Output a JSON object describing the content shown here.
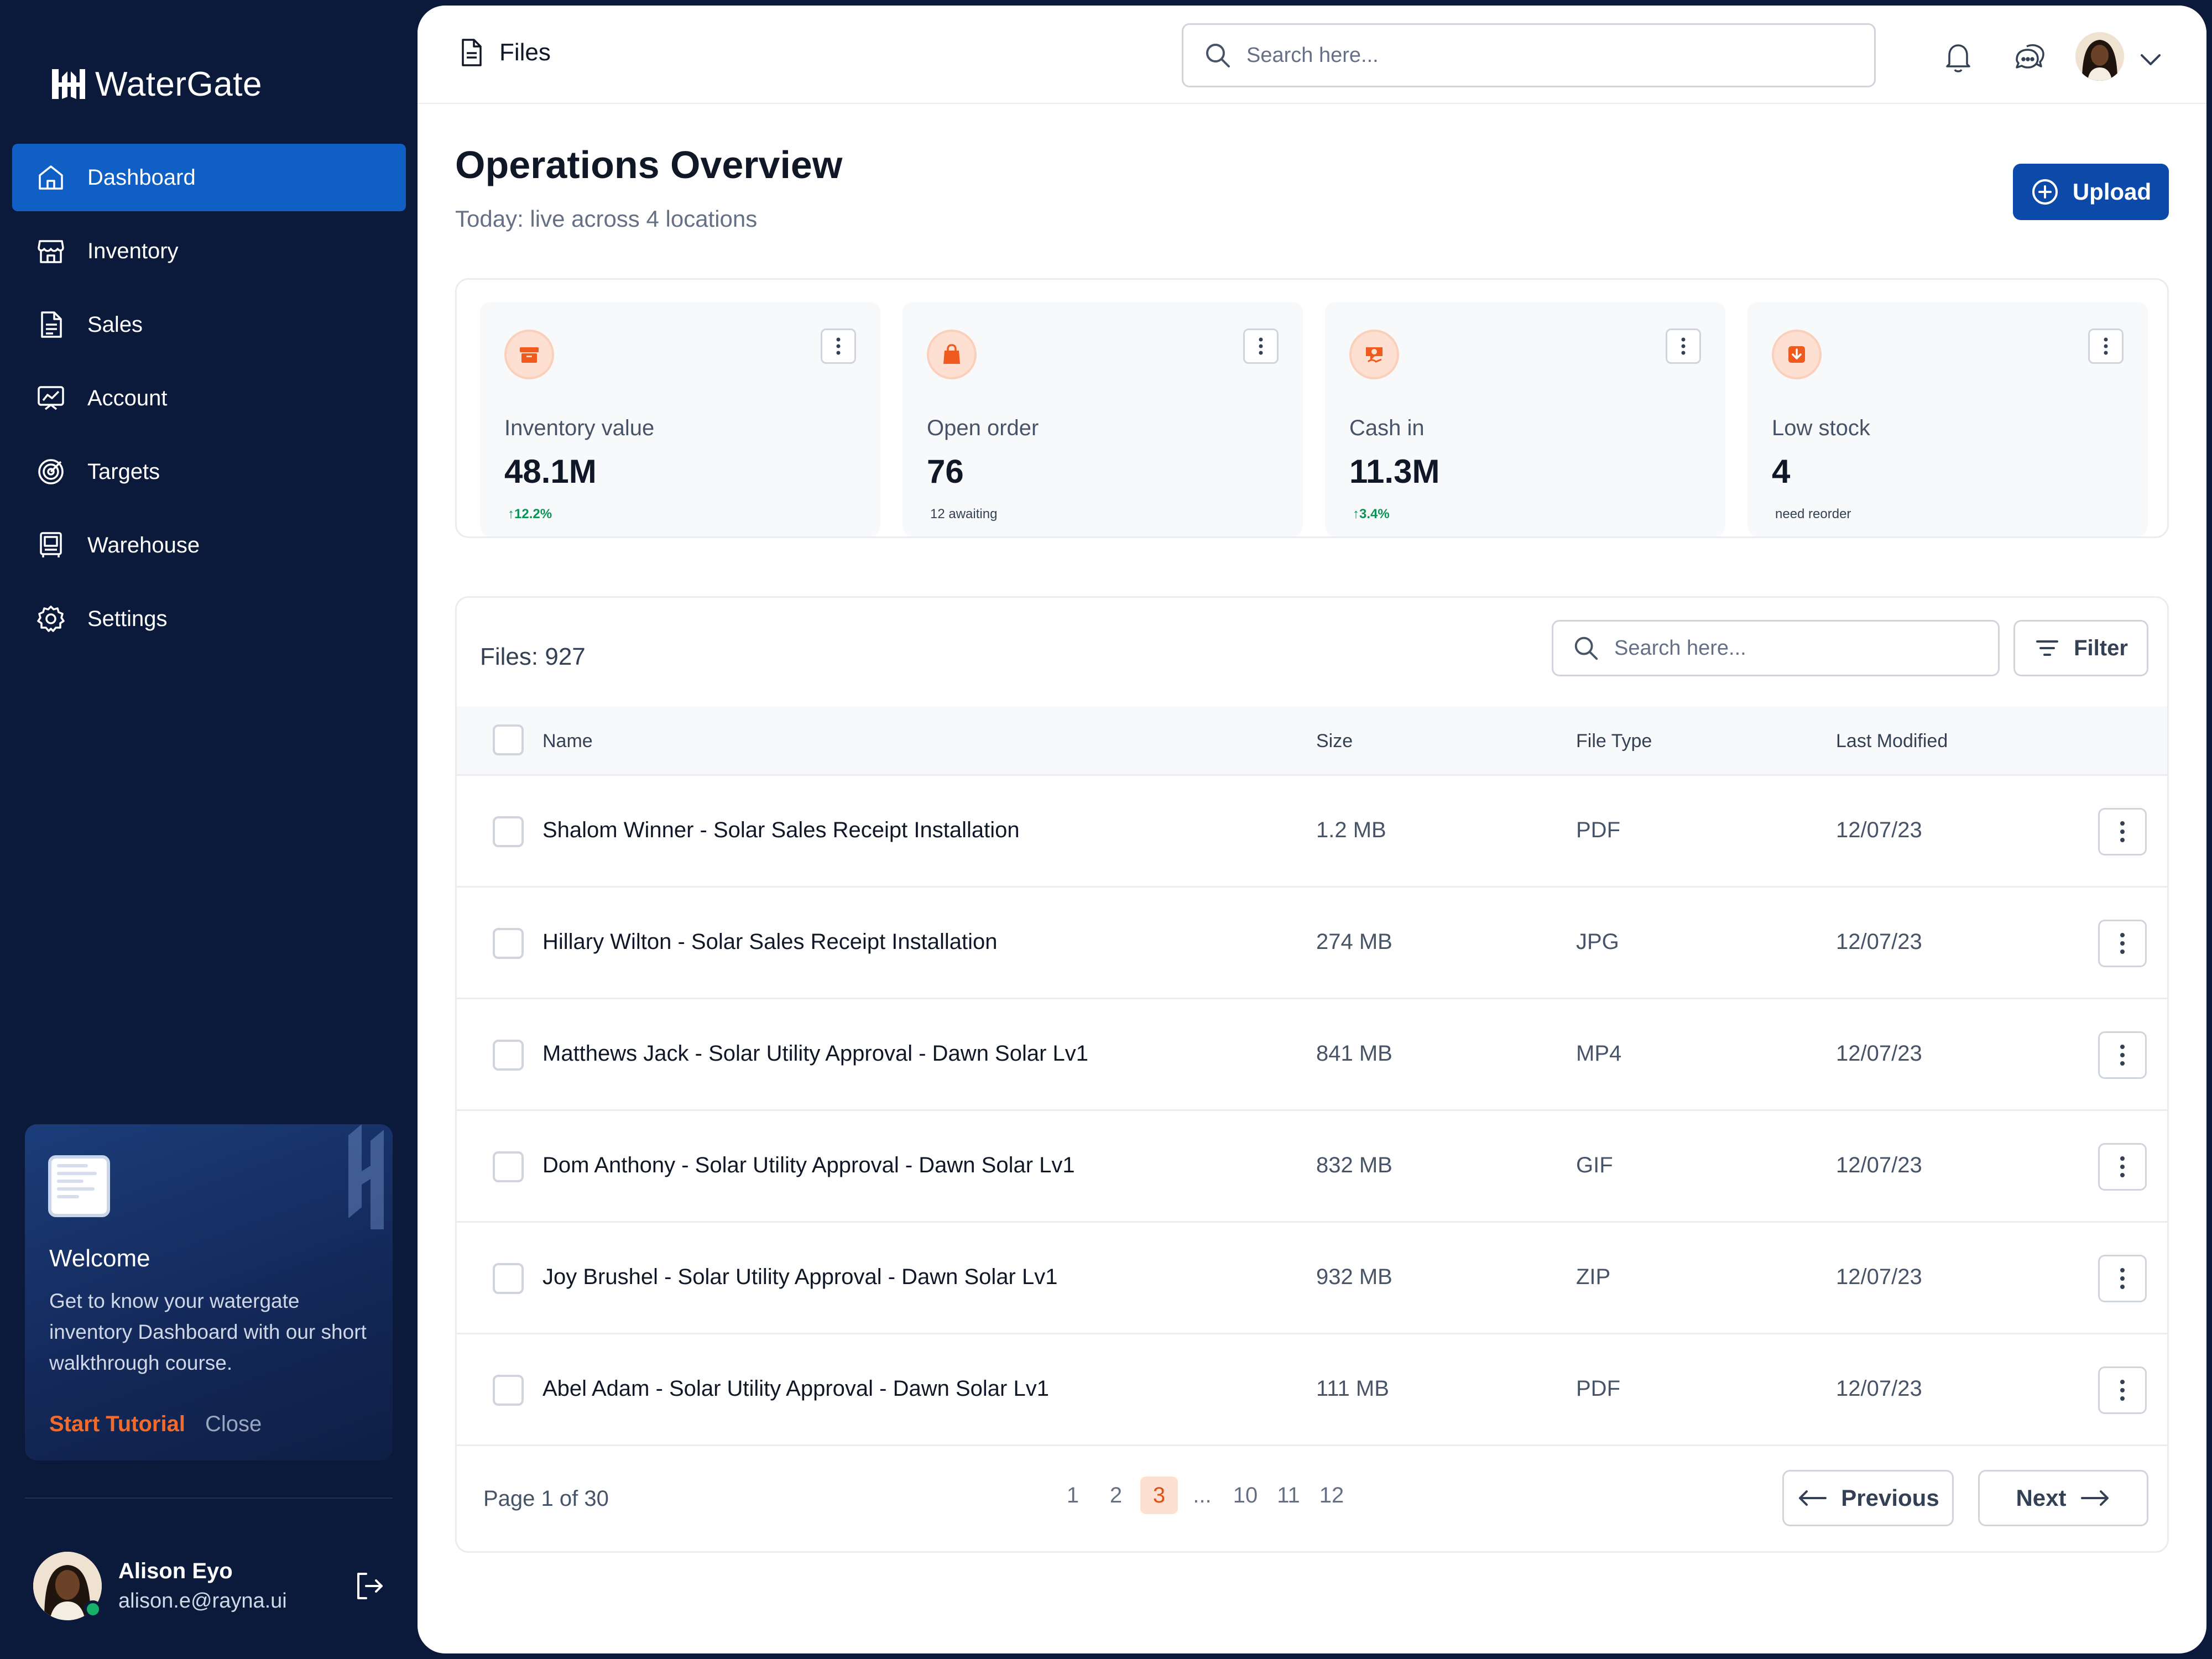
{
  "brand": {
    "name": "WaterGate"
  },
  "sidebar": {
    "items": [
      {
        "label": "Dashboard",
        "icon": "home-icon",
        "active": true
      },
      {
        "label": "Inventory",
        "icon": "store-icon"
      },
      {
        "label": "Sales",
        "icon": "document-icon"
      },
      {
        "label": "Account",
        "icon": "chart-icon"
      },
      {
        "label": "Targets",
        "icon": "target-icon"
      },
      {
        "label": "Warehouse",
        "icon": "building-icon"
      },
      {
        "label": "Settings",
        "icon": "gear-icon"
      }
    ],
    "promo": {
      "title": "Welcome",
      "text": "Get to know your watergate inventory Dashboard with our short walkthrough course.",
      "start_label": "Start Tutorial",
      "close_label": "Close"
    },
    "user": {
      "name": "Alison Eyo",
      "email": "alison.e@rayna.ui",
      "online": true
    }
  },
  "topbar": {
    "page_title": "Files",
    "search_placeholder": "Search here..."
  },
  "header": {
    "title": "Operations Overview",
    "subtitle": "Today: live across 4 locations",
    "upload_label": "Upload"
  },
  "stats": [
    {
      "label": "Inventory value",
      "value": "48.1M",
      "sub": "↑12.2%",
      "trend": "up",
      "icon": "archive-icon"
    },
    {
      "label": "Open order",
      "value": "76",
      "sub": "12 awaiting",
      "trend": "none",
      "icon": "bag-icon"
    },
    {
      "label": "Cash in",
      "value": "11.3M",
      "sub": "↑3.4%",
      "trend": "up",
      "icon": "cash-icon"
    },
    {
      "label": "Low stock",
      "value": "4",
      "sub": "need reorder",
      "trend": "none",
      "icon": "download-box-icon"
    }
  ],
  "files": {
    "count_label": "Files: 927",
    "search_placeholder": "Search here...",
    "filter_label": "Filter",
    "columns": [
      "Name",
      "Size",
      "File Type",
      "Last Modified"
    ],
    "rows": [
      {
        "name": "Shalom Winner - Solar Sales Receipt Installation",
        "size": "1.2 MB",
        "type": "PDF",
        "modified": "12/07/23"
      },
      {
        "name": "Hillary Wilton - Solar Sales Receipt Installation",
        "size": "274 MB",
        "type": "JPG",
        "modified": "12/07/23"
      },
      {
        "name": "Matthews Jack - Solar Utility Approval - Dawn Solar Lv1",
        "size": "841 MB",
        "type": "MP4",
        "modified": "12/07/23"
      },
      {
        "name": "Dom Anthony - Solar Utility Approval - Dawn Solar Lv1",
        "size": "832 MB",
        "type": "GIF",
        "modified": "12/07/23"
      },
      {
        "name": "Joy Brushel - Solar Utility Approval - Dawn Solar Lv1",
        "size": "932 MB",
        "type": "ZIP",
        "modified": "12/07/23"
      },
      {
        "name": "Abel Adam - Solar Utility Approval - Dawn Solar Lv1",
        "size": "111 MB",
        "type": "PDF",
        "modified": "12/07/23"
      }
    ],
    "pagination": {
      "label": "Page 1 of 30",
      "pages": [
        "1",
        "2",
        "3",
        "...",
        "10",
        "11",
        "12"
      ],
      "current": "3",
      "previous_label": "Previous",
      "next_label": "Next"
    }
  },
  "colors": {
    "sidebar_bg": "#0b1a3b",
    "active_nav": "#0f5fc4",
    "primary_button": "#0b4aa8",
    "accent_orange": "#f26b2d",
    "positive": "#079455"
  }
}
